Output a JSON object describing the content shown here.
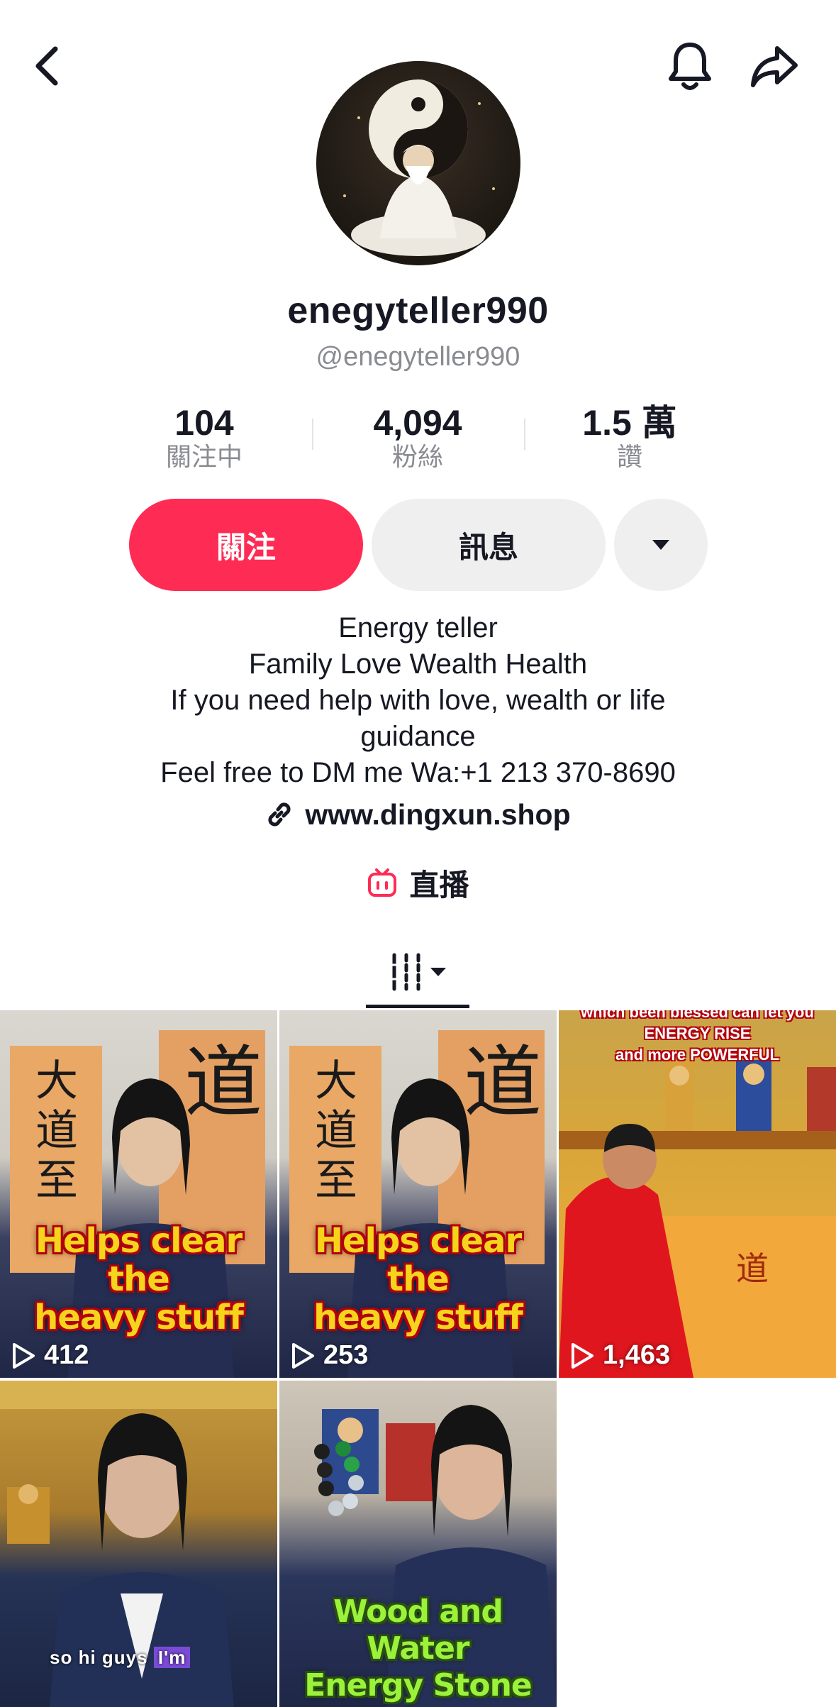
{
  "header": {
    "back_icon": "chevron-left-icon",
    "bell_icon": "bell-icon",
    "share_icon": "share-arrow-icon"
  },
  "profile": {
    "display_name": "enegyteller990",
    "handle": "@enegyteller990",
    "avatar_icon": "yin-yang-sage-avatar"
  },
  "stats": [
    {
      "value": "104",
      "label": "關注中"
    },
    {
      "value": "4,094",
      "label": "粉絲"
    },
    {
      "value": "1.5 萬",
      "label": "讚"
    }
  ],
  "actions": {
    "follow_label": "關注",
    "message_label": "訊息",
    "more_icon": "caret-down-icon",
    "follow_color": "#fe2c55"
  },
  "bio": {
    "lines": [
      "Energy teller",
      "Family Love Wealth Health",
      "If you need help with love, wealth or life",
      "guidance",
      "Feel free to DM me Wa:+1 213 370-8690"
    ],
    "link": "www.dingxun.shop",
    "live_label": "直播"
  },
  "tabs": {
    "active_icon": "videos-grid-icon"
  },
  "videos": [
    {
      "views": "412",
      "caption_1": "Helps clear the",
      "caption_2": "heavy stuff"
    },
    {
      "views": "253",
      "caption_1": "Helps clear the",
      "caption_2": "heavy stuff"
    },
    {
      "views": "1,463",
      "top_text_1": "which been blessed can let you",
      "top_text_2": "ENERGY RISE",
      "top_text_3": "and more POWERFUL"
    },
    {
      "subtitle_plain": "so hi guys",
      "subtitle_hl": "I'm"
    },
    {
      "caption_1": "Wood and Water",
      "caption_2": "Energy Stone"
    }
  ]
}
